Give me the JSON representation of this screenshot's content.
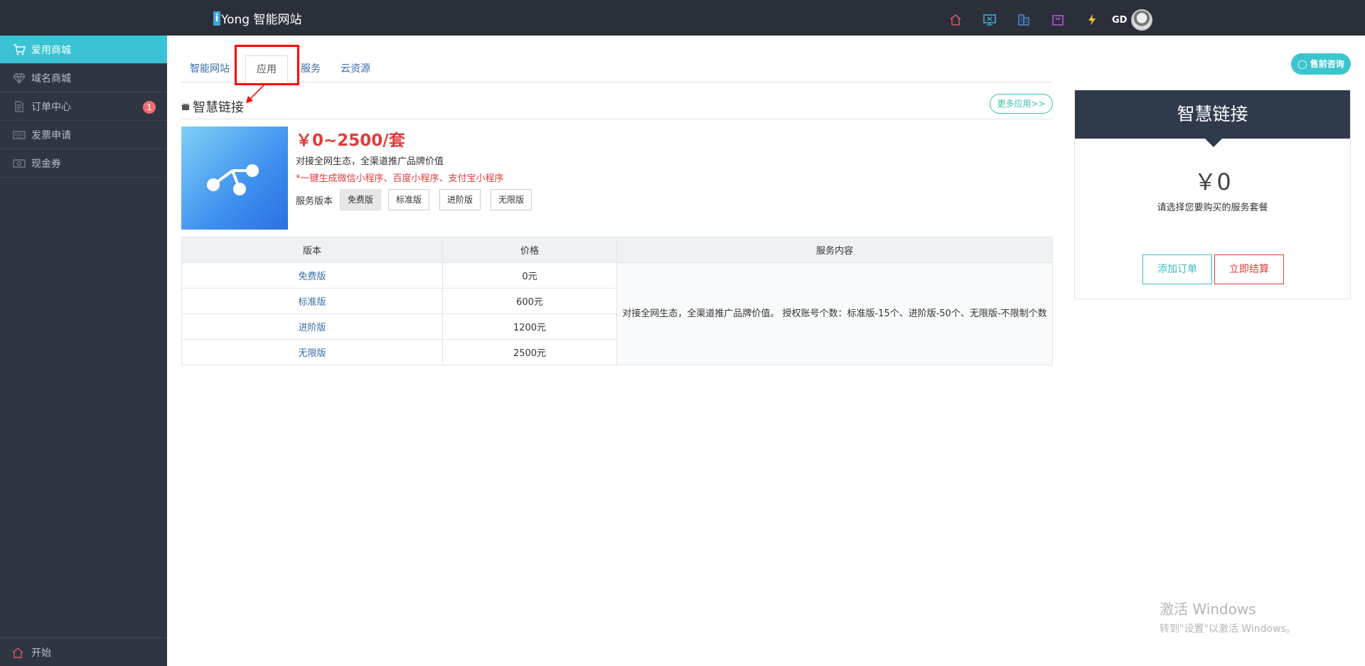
{
  "header": {
    "brand_i": "i",
    "brand_rest": "Yong 智能网站",
    "icons": [
      "home-icon",
      "monitor-icon",
      "building-icon",
      "bag-icon",
      "lightning-icon"
    ],
    "user_name": "GD"
  },
  "sidebar": {
    "items": [
      {
        "label": "爱用商城",
        "icon": "cart-icon"
      },
      {
        "label": "域名商城",
        "icon": "diamond-icon"
      },
      {
        "label": "订单中心",
        "icon": "document-icon",
        "badge": "1"
      },
      {
        "label": "发票申请",
        "icon": "keyboard-icon"
      },
      {
        "label": "现金券",
        "icon": "cash-icon"
      }
    ],
    "bottom_label": "开始"
  },
  "tabs": [
    {
      "label": "智能网站"
    },
    {
      "label": "应用"
    },
    {
      "label": "服务"
    },
    {
      "label": "云资源"
    }
  ],
  "presale_label": "售前咨询",
  "section": {
    "title": "智慧链接",
    "more_label": "更多应用>>"
  },
  "product": {
    "price": "￥0~2500/套",
    "description": "对接全网生态，全渠道推广品牌价值",
    "highlight": "*一键生成微信小程序、百度小程序、支付宝小程序",
    "version_label": "服务版本",
    "versions": [
      "免费版",
      "标准版",
      "进阶版",
      "无限版"
    ],
    "selected_version": "免费版"
  },
  "table": {
    "headers": [
      "版本",
      "价格",
      "服务内容"
    ],
    "rows": [
      {
        "version": "免费版",
        "price": "0元"
      },
      {
        "version": "标准版",
        "price": "600元"
      },
      {
        "version": "进阶版",
        "price": "1200元"
      },
      {
        "version": "无限版",
        "price": "2500元"
      }
    ],
    "service_content": "对接全网生态，全渠道推广品牌价值。 授权账号个数：标准版-15个、进阶版-50个、无限版-不限制个数"
  },
  "card": {
    "title": "智慧链接",
    "price": "￥0",
    "tip": "请选择您要购买的服务套餐",
    "add_label": "添加订单",
    "pay_label": "立即结算"
  },
  "watermark": {
    "line1": "激活 Windows",
    "line2": "转到\"设置\"以激活 Windows。"
  },
  "colors": {
    "topbar": "#2b2f3a",
    "sidebar": "#2f3642",
    "sidebar_active": "#39c3d4",
    "accent_red": "#e23b3b",
    "accent_teal": "#3bbfc4",
    "link_blue": "#3a6ca8"
  }
}
